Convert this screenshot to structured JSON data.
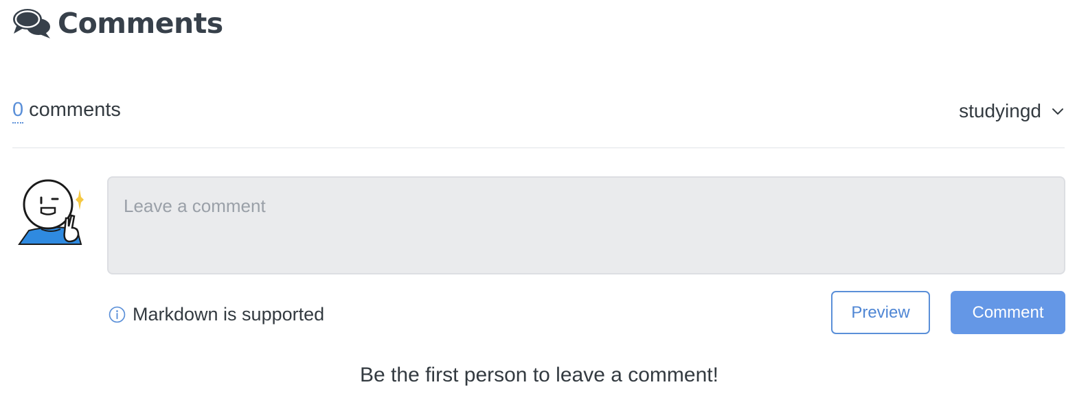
{
  "heading": {
    "icon": "comments-icon",
    "title": "Comments"
  },
  "meta": {
    "comment_count": "0",
    "comment_count_suffix": "comments",
    "username": "studyingd",
    "user_menu_icon": "chevron-down-icon"
  },
  "composer": {
    "avatar": "avatar-image",
    "placeholder": "Leave a comment",
    "value": "",
    "markdown_hint": "Markdown is supported",
    "markdown_icon": "info-icon",
    "preview_label": "Preview",
    "comment_label": "Comment"
  },
  "empty_state": {
    "message": "Be the first person to leave a comment!"
  },
  "colors": {
    "accent": "#5a8fd8",
    "comment_button": "#6497e6",
    "textarea_bg": "#eaebed",
    "text": "#333a40"
  }
}
